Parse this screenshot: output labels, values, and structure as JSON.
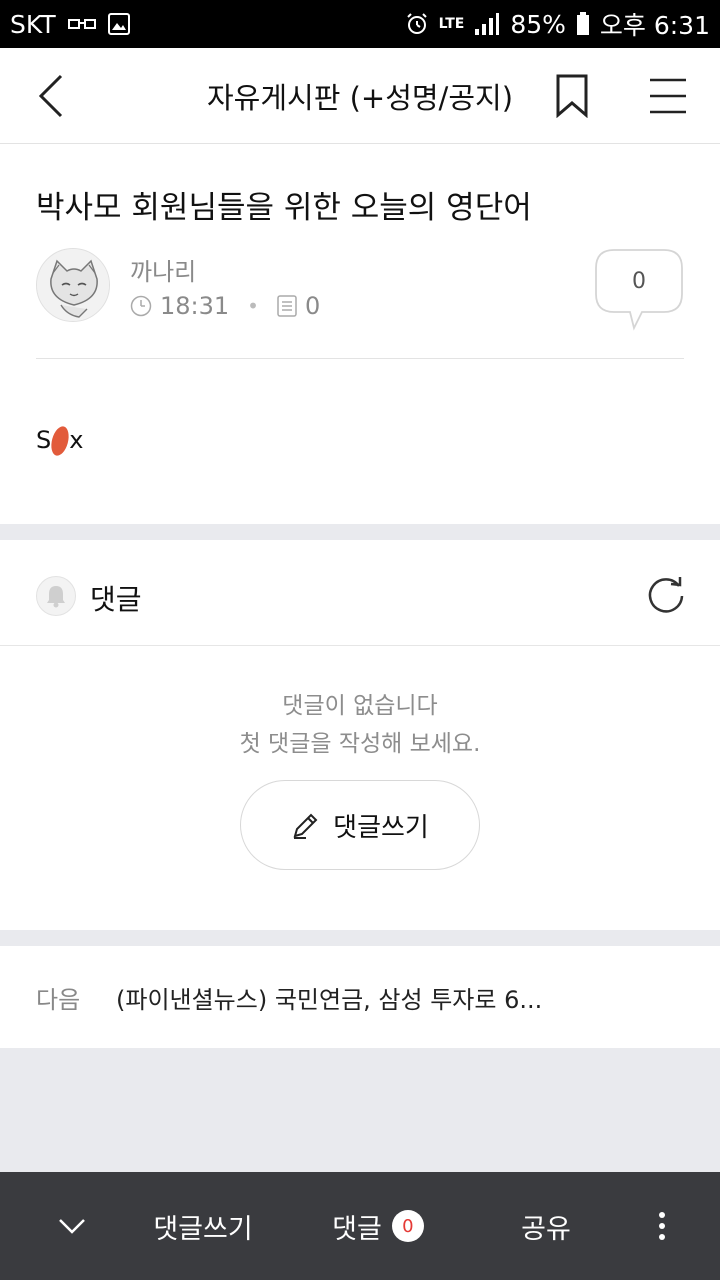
{
  "status_bar": {
    "carrier": "SKT",
    "network": "LTE",
    "battery": "85%",
    "time": "오후 6:31"
  },
  "header": {
    "title": "자유게시판 (+성명/공지)"
  },
  "post": {
    "title": "박사모 회원님들을 위한 오늘의 영단어",
    "author": "까나리",
    "time": "18:31",
    "view_count": "0",
    "comment_count": "0",
    "body_start": "S",
    "body_end": "x"
  },
  "comments": {
    "label": "댓글",
    "empty_line1": "댓글이 없습니다",
    "empty_line2": "첫 댓글을 작성해 보세요.",
    "write_button": "댓글쓰기"
  },
  "next_post": {
    "tag": "다음",
    "title": "(파이낸셜뉴스) 국민연금, 삼성 투자로 6..."
  },
  "toolbar": {
    "write_comment": "댓글쓰기",
    "comments": "댓글",
    "comments_badge": "0",
    "share": "공유"
  },
  "colors": {
    "toolbar_bg": "#3a3b3f",
    "badge_text": "#e53935",
    "scribble": "#e25b3b"
  }
}
